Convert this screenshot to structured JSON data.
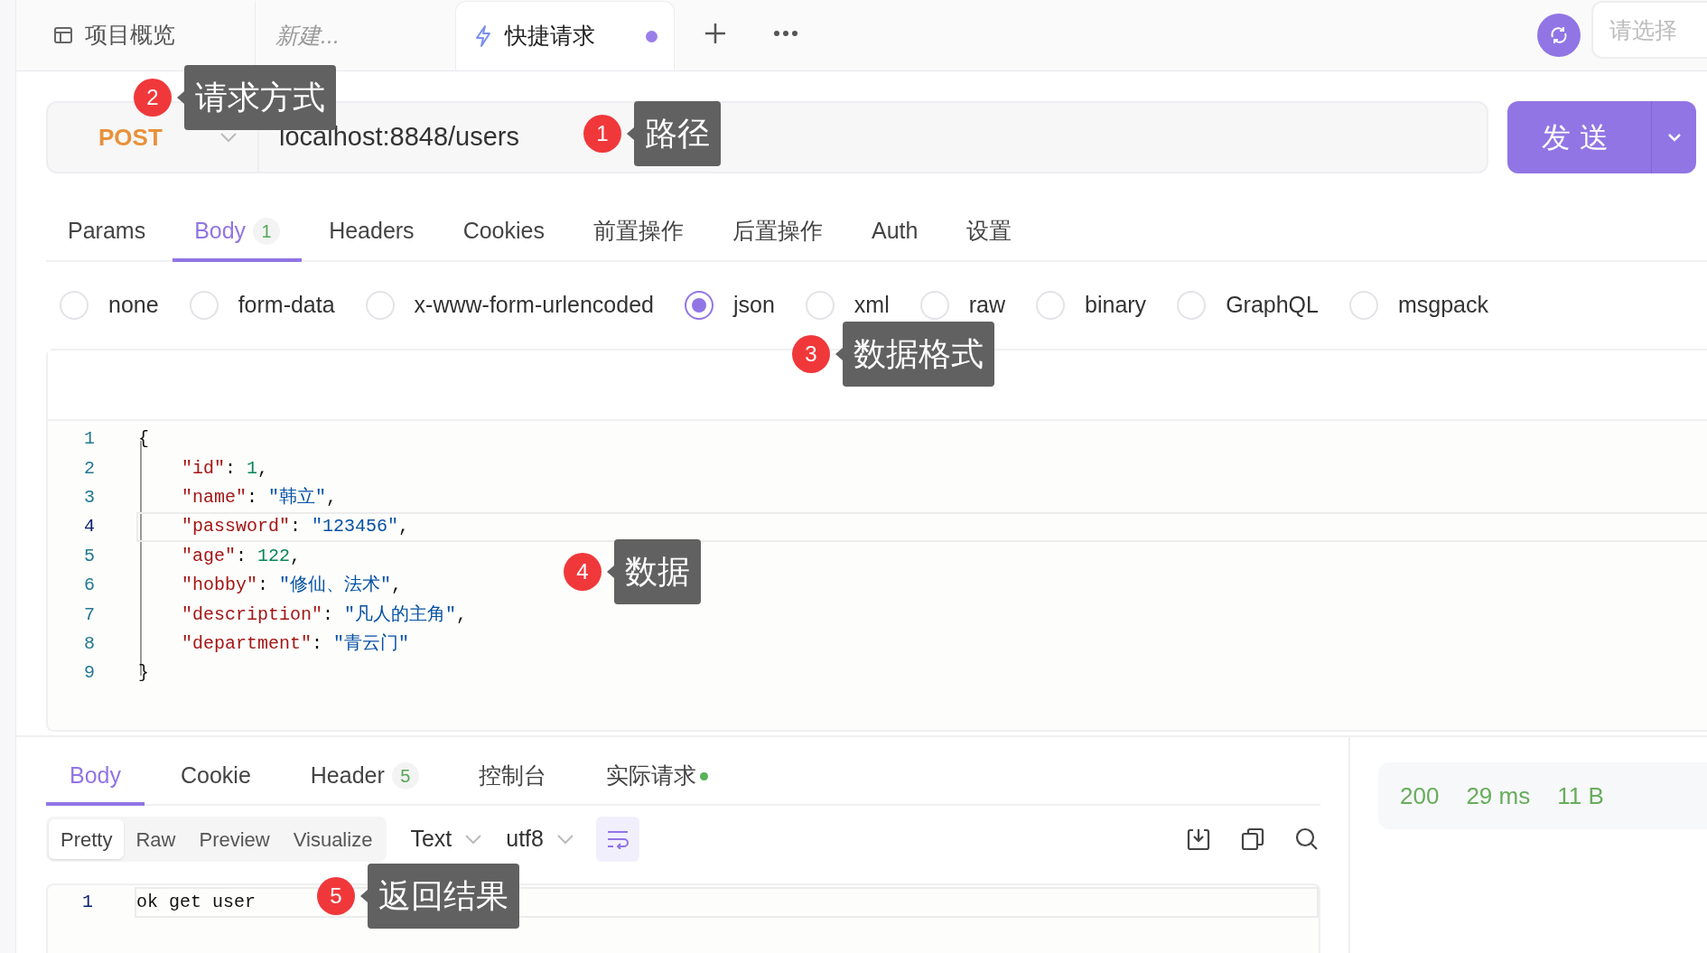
{
  "tabs": [
    {
      "kind": "overview",
      "label": "项目概览",
      "selected": false,
      "unsaved": false
    },
    {
      "kind": "draft",
      "label": "新建...",
      "selected": false,
      "unsaved": false
    },
    {
      "kind": "request",
      "label": "快捷请求",
      "selected": true,
      "unsaved": true
    }
  ],
  "environment": {
    "placeholder": "请选择"
  },
  "request": {
    "method": "POST",
    "url": "localhost:8848/users",
    "send": "发送"
  },
  "request_tabs": [
    {
      "label": "Params",
      "selected": false
    },
    {
      "label": "Body",
      "badge": "1",
      "selected": true
    },
    {
      "label": "Headers",
      "selected": false
    },
    {
      "label": "Cookies",
      "selected": false
    },
    {
      "label": "前置操作",
      "selected": false
    },
    {
      "label": "后置操作",
      "selected": false
    },
    {
      "label": "Auth",
      "selected": false
    },
    {
      "label": "设置",
      "selected": false
    }
  ],
  "body_types": [
    {
      "label": "none",
      "selected": false
    },
    {
      "label": "form-data",
      "selected": false
    },
    {
      "label": "x-www-form-urlencoded",
      "selected": false
    },
    {
      "label": "json",
      "selected": true
    },
    {
      "label": "xml",
      "selected": false
    },
    {
      "label": "raw",
      "selected": false
    },
    {
      "label": "binary",
      "selected": false
    },
    {
      "label": "GraphQL",
      "selected": false
    },
    {
      "label": "msgpack",
      "selected": false
    }
  ],
  "editor": {
    "lines": [
      {
        "number": "1",
        "code": "{",
        "selected": false
      },
      {
        "number": "2",
        "code": "    \"id\": 1,",
        "selected": false
      },
      {
        "number": "3",
        "code": "    \"name\": \"韩立\",",
        "selected": false
      },
      {
        "number": "4",
        "code": "    \"password\": \"123456\",",
        "selected": true
      },
      {
        "number": "5",
        "code": "    \"age\": 122,",
        "selected": false
      },
      {
        "number": "6",
        "code": "    \"hobby\": \"修仙、法术\",",
        "selected": false
      },
      {
        "number": "7",
        "code": "    \"description\": \"凡人的主角\",",
        "selected": false
      },
      {
        "number": "8",
        "code": "    \"department\": \"青云门\"",
        "selected": false
      },
      {
        "number": "9",
        "code": "}",
        "selected": false
      }
    ]
  },
  "response": {
    "tabs": [
      {
        "label": "Body",
        "selected": true,
        "indicator": false
      },
      {
        "label": "Cookie",
        "selected": false,
        "indicator": false
      },
      {
        "label": "Header",
        "badge": "5",
        "selected": false,
        "indicator": false
      },
      {
        "label": "控制台",
        "selected": false,
        "indicator": false
      },
      {
        "label": "实际请求",
        "selected": false,
        "indicator": true
      }
    ],
    "view_modes": [
      {
        "label": "Pretty",
        "selected": true
      },
      {
        "label": "Raw",
        "selected": false
      },
      {
        "label": "Preview",
        "selected": false
      },
      {
        "label": "Visualize",
        "selected": false
      }
    ],
    "format": "Text",
    "encoding": "utf8",
    "wrap": true,
    "lines": [
      {
        "number": "1",
        "code": "ok get user"
      }
    ],
    "status": {
      "code": "200",
      "time": "29 ms",
      "size": "11 B"
    }
  },
  "callouts": [
    {
      "number": "1",
      "label": "路径"
    },
    {
      "number": "2",
      "label": "请求方式"
    },
    {
      "number": "3",
      "label": "数据格式"
    },
    {
      "number": "4",
      "label": "数据"
    },
    {
      "number": "5",
      "label": "返回结果"
    }
  ]
}
